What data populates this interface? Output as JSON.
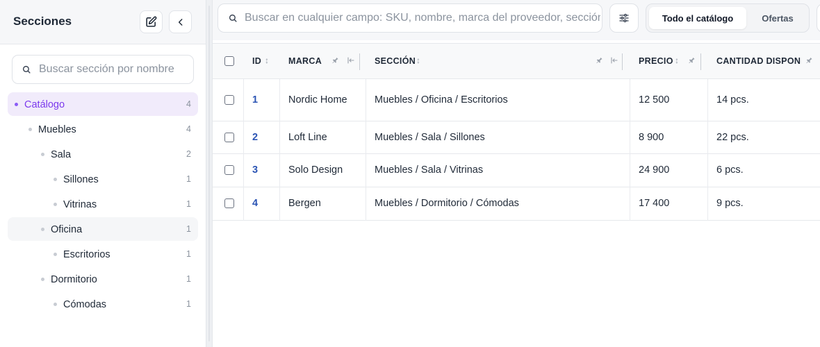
{
  "sidebar": {
    "title": "Secciones",
    "search_placeholder": "Buscar sección por nombre",
    "tree": [
      {
        "label": "Catálogo",
        "count": "4",
        "level": 0,
        "state": "active"
      },
      {
        "label": "Muebles",
        "count": "4",
        "level": 1,
        "state": "normal"
      },
      {
        "label": "Sala",
        "count": "2",
        "level": 2,
        "state": "normal"
      },
      {
        "label": "Sillones",
        "count": "1",
        "level": 3,
        "state": "normal"
      },
      {
        "label": "Vitrinas",
        "count": "1",
        "level": 3,
        "state": "normal"
      },
      {
        "label": "Oficina",
        "count": "1",
        "level": 2,
        "state": "hover"
      },
      {
        "label": "Escritorios",
        "count": "1",
        "level": 3,
        "state": "normal"
      },
      {
        "label": "Dormitorio",
        "count": "1",
        "level": 2,
        "state": "normal"
      },
      {
        "label": "Cómodas",
        "count": "1",
        "level": 3,
        "state": "normal"
      }
    ]
  },
  "toolbar": {
    "search_placeholder": "Buscar en cualquier campo: SKU, nombre, marca del proveedor, sección...",
    "tabs": [
      {
        "label": "Todo el catálogo",
        "selected": true
      },
      {
        "label": "Ofertas",
        "selected": false
      }
    ]
  },
  "table": {
    "columns": {
      "id": "ID",
      "brand": "MARCA",
      "section": "SECCIÓN",
      "price": "PRECIO",
      "qty": "CANTIDAD DISPONIBLE"
    },
    "rows": [
      {
        "id": "1",
        "brand": "Nordic Home",
        "section": "Muebles / Oficina / Escritorios",
        "price": "12 500",
        "qty": "14 pcs."
      },
      {
        "id": "2",
        "brand": "Loft Line",
        "section": "Muebles / Sala / Sillones",
        "price": "8 900",
        "qty": "22 pcs."
      },
      {
        "id": "3",
        "brand": "Solo Design",
        "section": "Muebles / Sala / Vitrinas",
        "price": "24 900",
        "qty": "6 pcs."
      },
      {
        "id": "4",
        "brand": "Bergen",
        "section": "Muebles / Dormitorio / Cómodas",
        "price": "17 400",
        "qty": "9 pcs."
      }
    ]
  },
  "colors": {
    "accent": "#7c3aed",
    "accent_bg": "#f1ebfb",
    "link": "#2c55b4"
  },
  "icons": {
    "edit": "edit-icon",
    "collapse_sidebar": "chevron-left-icon",
    "search": "search-icon",
    "filters": "sliders-icon",
    "sort": "sort-arrows-icon",
    "pin": "pin-icon",
    "collapse_column": "column-collapse-icon"
  }
}
